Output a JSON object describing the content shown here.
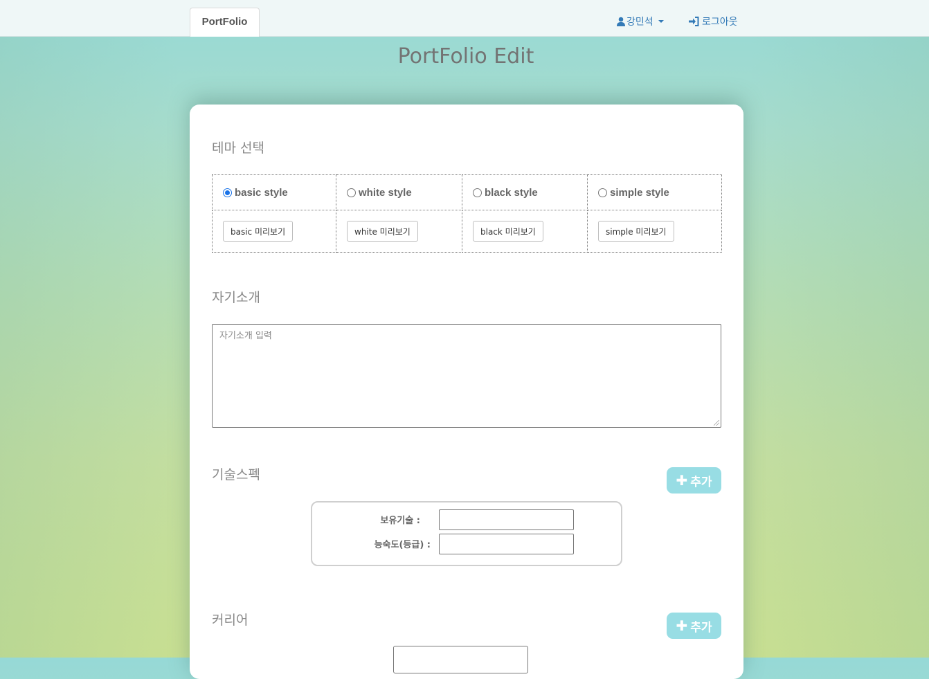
{
  "navbar": {
    "brand": "PortFolio",
    "user_name": "강민석",
    "logout_label": "로그아웃"
  },
  "page_title": "PortFolio Edit",
  "theme_section": {
    "title": "테마 선택",
    "options": [
      {
        "label": "basic style",
        "preview_label": "basic 미리보기",
        "checked": true
      },
      {
        "label": "white style",
        "preview_label": "white 미리보기",
        "checked": false
      },
      {
        "label": "black style",
        "preview_label": "black 미리보기",
        "checked": false
      },
      {
        "label": "simple style",
        "preview_label": "simple 미리보기",
        "checked": false
      }
    ]
  },
  "intro_section": {
    "title": "자기소개",
    "placeholder": "자기소개 입력",
    "value": ""
  },
  "skills_section": {
    "title": "기술스펙",
    "add_label": "추가",
    "skill_label": "보유기술 :",
    "skill_value": "",
    "level_label": "능숙도(등급) :",
    "level_value": ""
  },
  "career_section": {
    "title": "커리어",
    "add_label": "추가"
  },
  "colors": {
    "link": "#337ab7",
    "add_button": "#98dde4",
    "radio_checked": "#1a73e8"
  }
}
